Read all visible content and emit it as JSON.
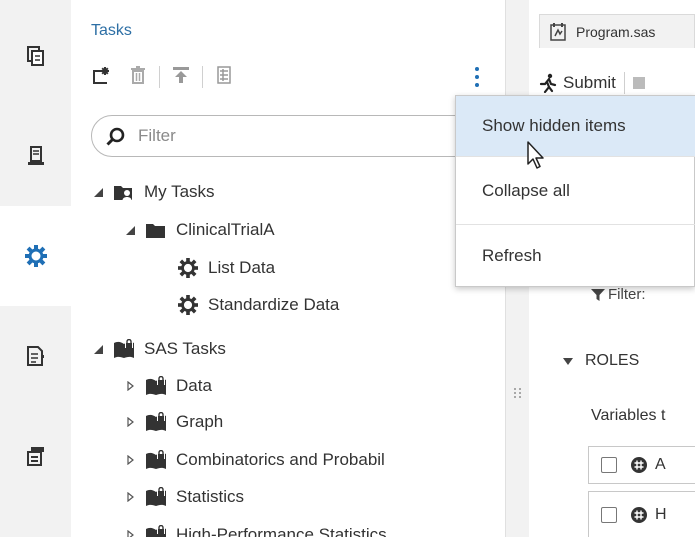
{
  "colors": {
    "accent": "#1f6fb5",
    "title_blue": "#2d6fa5",
    "menu_hover": "#dbe9f7",
    "nav_bg": "#f2f2f2"
  },
  "nav": {
    "items": [
      {
        "name": "document-icon",
        "active": false
      },
      {
        "name": "server-icon",
        "active": false
      },
      {
        "name": "tasks-gear-icon",
        "active": true
      },
      {
        "name": "program-snippet-icon",
        "active": false
      },
      {
        "name": "library-cabinet-icon",
        "active": false
      }
    ]
  },
  "tasks_panel": {
    "title": "Tasks",
    "toolbar": {
      "icons": [
        "new-task-icon",
        "delete-icon",
        "upload-icon",
        "properties-icon",
        "more-options-icon"
      ]
    },
    "filter": {
      "placeholder": "Filter",
      "value": ""
    },
    "tree": [
      {
        "label": "My Tasks",
        "icon": "user-folder-icon",
        "expanded": true
      },
      {
        "label": "ClinicalTrialA",
        "icon": "folder-icon",
        "expanded": true
      },
      {
        "label": "List Data",
        "icon": "task-gear-icon"
      },
      {
        "label": "Standardize Data",
        "icon": "task-gear-icon"
      },
      {
        "label": "SAS Tasks",
        "icon": "locked-book-icon",
        "expanded": true
      },
      {
        "label": "Data",
        "icon": "locked-book-icon",
        "expanded": false
      },
      {
        "label": "Graph",
        "icon": "locked-book-icon",
        "expanded": false
      },
      {
        "label": "Combinatorics and Probabil",
        "icon": "locked-book-icon",
        "expanded": false
      },
      {
        "label": "Statistics",
        "icon": "locked-book-icon",
        "expanded": false
      },
      {
        "label": "High-Performance Statistics",
        "icon": "locked-book-icon",
        "expanded": false
      }
    ]
  },
  "context_menu": {
    "items": [
      {
        "label": "Show hidden items",
        "hovered": true
      },
      {
        "label": "Collapse all",
        "hovered": false
      },
      {
        "label": "Refresh",
        "hovered": false
      }
    ]
  },
  "program_pane": {
    "tab_label": "Program.sas",
    "submit_label": "Submit",
    "filter_label": "Filter:",
    "roles_label": "ROLES",
    "variables_label": "Variables t",
    "variables": [
      {
        "label": "A"
      },
      {
        "label": "H"
      }
    ]
  }
}
